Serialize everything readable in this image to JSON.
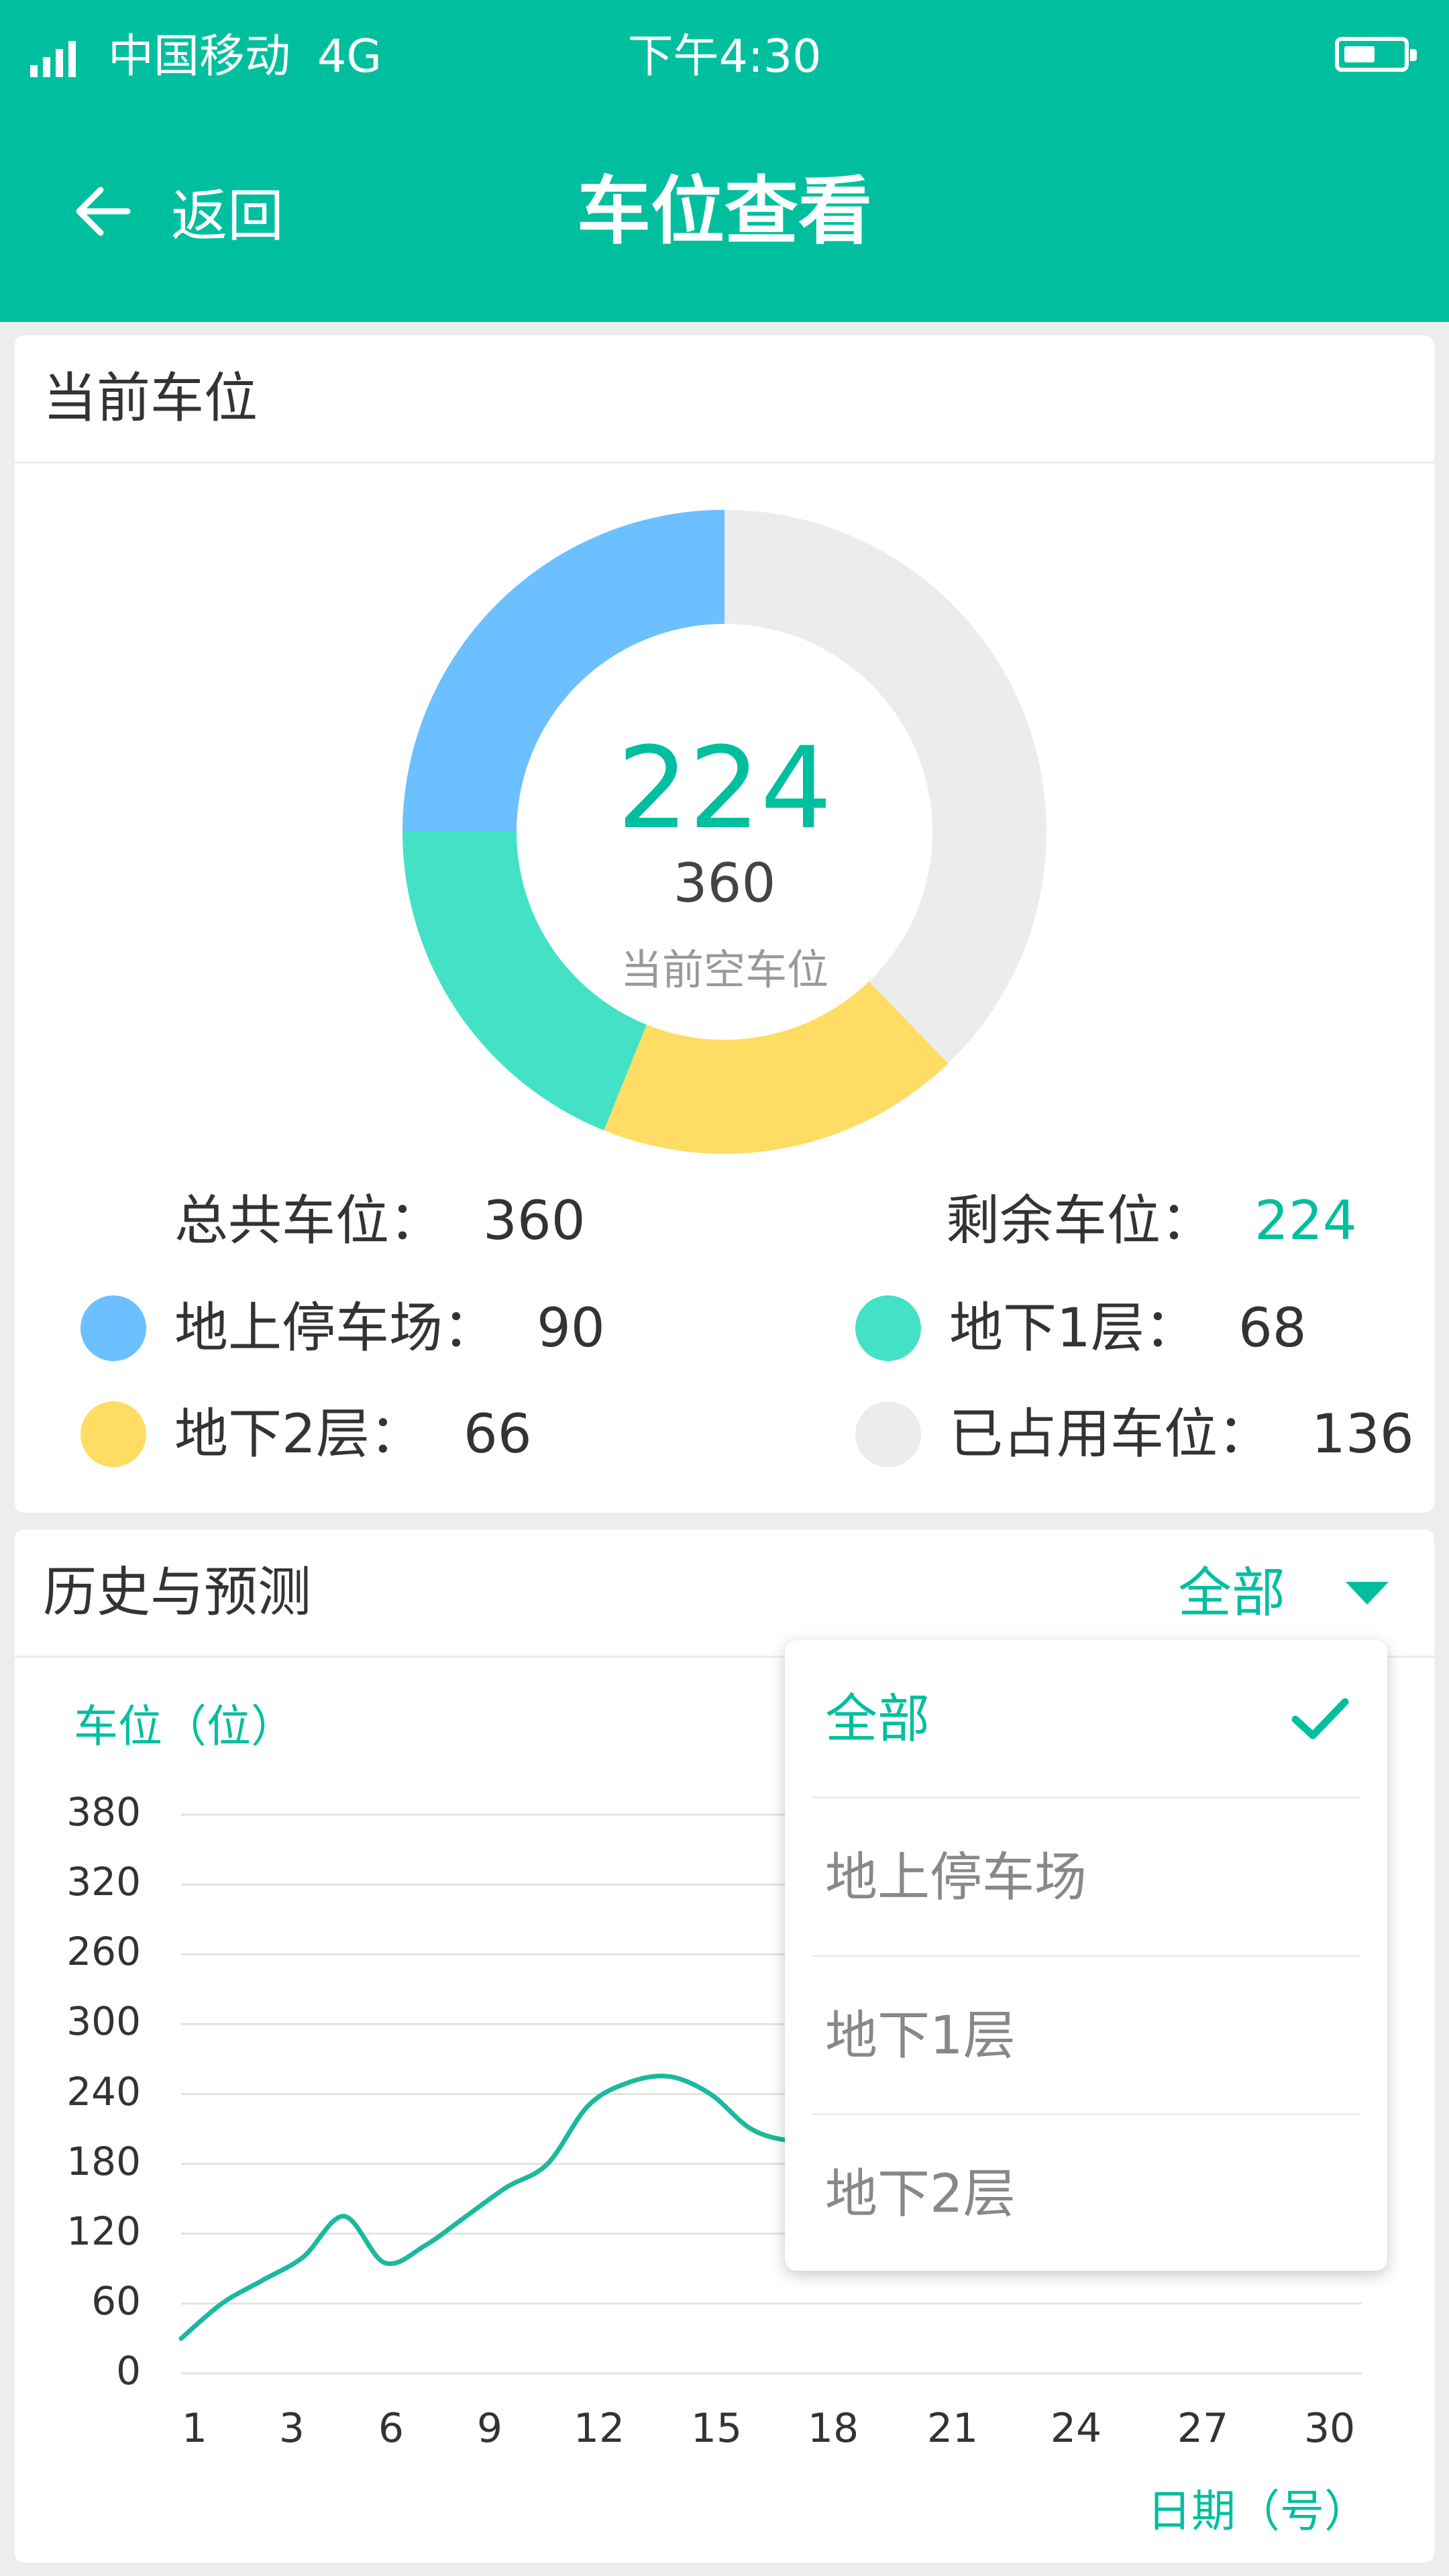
{
  "status_bar": {
    "carrier": "中国移动",
    "network": "4G",
    "time": "下午4:30"
  },
  "nav": {
    "back_label": "返回",
    "title": "车位查看"
  },
  "current": {
    "section_title": "当前车位",
    "center_value": "224",
    "center_total": "360",
    "center_caption": "当前空车位",
    "total_label": "总共车位：",
    "total_value": "360",
    "remaining_label": "剩余车位：",
    "remaining_value": "224",
    "segments": [
      {
        "label": "地上停车场：",
        "value": 90,
        "value_text": "90",
        "color": "#6cc0ff"
      },
      {
        "label": "地下1层：",
        "value": 68,
        "value_text": "68",
        "color": "#43e2c6"
      },
      {
        "label": "地下2层：",
        "value": 66,
        "value_text": "66",
        "color": "#ffdc64"
      },
      {
        "label": "已占用车位：",
        "value": 136,
        "value_text": "136",
        "color": "#ececec"
      }
    ]
  },
  "history": {
    "section_title": "历史与预测",
    "filter_value": "全部",
    "y_axis_label": "车位（位）",
    "x_axis_label": "日期（号）",
    "y_ticks": [
      "380",
      "320",
      "260",
      "300",
      "240",
      "180",
      "120",
      "60",
      "0"
    ],
    "x_ticks": [
      "1",
      "3",
      "6",
      "9",
      "12",
      "15",
      "18",
      "21",
      "24",
      "27",
      "30"
    ]
  },
  "dropdown": {
    "items": [
      {
        "label": "全部",
        "selected": true
      },
      {
        "label": "地上停车场",
        "selected": false
      },
      {
        "label": "地下1层",
        "selected": false
      },
      {
        "label": "地下2层",
        "selected": false
      }
    ]
  },
  "chart_data": {
    "type": "line",
    "title": "",
    "xlabel": "日期（号）",
    "ylabel": "车位（位）",
    "y_tick_labels": [
      "0",
      "60",
      "120",
      "180",
      "240",
      "300",
      "260",
      "320",
      "380"
    ],
    "ylim": [
      0,
      480
    ],
    "xlim": [
      1,
      30
    ],
    "grid": true,
    "series": [
      {
        "x": [
          1,
          2,
          3,
          4,
          5,
          6,
          7,
          8,
          9,
          10,
          11,
          12,
          13,
          14,
          15,
          16,
          17
        ],
        "values": [
          30,
          60,
          80,
          100,
          135,
          95,
          110,
          135,
          160,
          180,
          230,
          250,
          255,
          240,
          210,
          200,
          205
        ]
      }
    ]
  }
}
